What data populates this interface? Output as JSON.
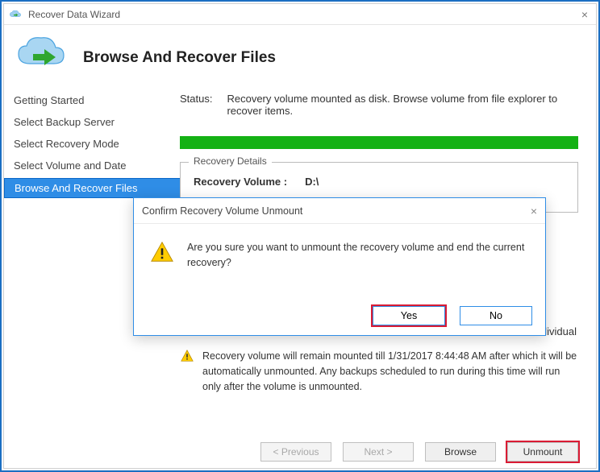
{
  "window": {
    "title": "Recover Data Wizard"
  },
  "header": {
    "heading": "Browse And Recover Files"
  },
  "sidebar": {
    "items": [
      {
        "label": "Getting Started"
      },
      {
        "label": "Select Backup Server"
      },
      {
        "label": "Select Recovery Mode"
      },
      {
        "label": "Select Volume and Date"
      },
      {
        "label": "Browse And Recover Files"
      }
    ],
    "activeIndex": 4
  },
  "status": {
    "label": "Status:",
    "text": "Recovery volume mounted as disk. Browse volume from file explorer to recover items."
  },
  "recovery": {
    "group": "Recovery Details",
    "volumeLabel": "Recovery Volume  :",
    "volumeValue": "D:\\"
  },
  "hintTail": "cover individual",
  "warning": {
    "text": "Recovery volume will remain mounted till 1/31/2017 8:44:48 AM after which it will be automatically unmounted. Any backups scheduled to run during this time will run only after the volume is unmounted."
  },
  "footer": {
    "prev": "< Previous",
    "next": "Next >",
    "browse": "Browse",
    "unmount": "Unmount"
  },
  "dialog": {
    "title": "Confirm Recovery Volume Unmount",
    "message": "Are you sure you want to unmount the recovery volume and end the current recovery?",
    "yes": "Yes",
    "no": "No"
  },
  "colors": {
    "accent": "#2f8de6",
    "danger": "#da1b34",
    "progress": "#14b114"
  }
}
